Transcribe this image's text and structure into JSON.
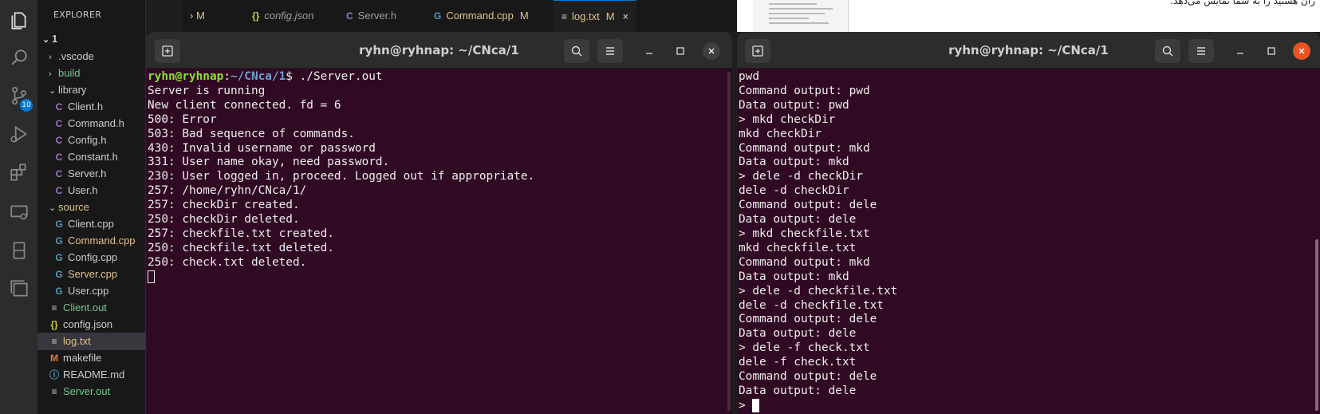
{
  "vscode": {
    "explorer_title": "EXPLORER",
    "explorer_more": "···",
    "source_control_badge": "10",
    "folder_name": "1",
    "tree": [
      {
        "kind": "folder",
        "label": ".vscode",
        "expanded": false,
        "indent": 1,
        "color": "#cccccc"
      },
      {
        "kind": "folder",
        "label": "build",
        "expanded": false,
        "indent": 1,
        "color": "#73c991"
      },
      {
        "kind": "folder",
        "label": "library",
        "expanded": true,
        "indent": 1,
        "color": "#cccccc"
      },
      {
        "kind": "file",
        "icon": "C",
        "icon_color": "#a074c4",
        "label": "Client.h",
        "indent": 2,
        "color": "#cccccc"
      },
      {
        "kind": "file",
        "icon": "C",
        "icon_color": "#a074c4",
        "label": "Command.h",
        "indent": 2,
        "color": "#cccccc"
      },
      {
        "kind": "file",
        "icon": "C",
        "icon_color": "#a074c4",
        "label": "Config.h",
        "indent": 2,
        "color": "#cccccc"
      },
      {
        "kind": "file",
        "icon": "C",
        "icon_color": "#a074c4",
        "label": "Constant.h",
        "indent": 2,
        "color": "#cccccc"
      },
      {
        "kind": "file",
        "icon": "C",
        "icon_color": "#a074c4",
        "label": "Server.h",
        "indent": 2,
        "color": "#cccccc"
      },
      {
        "kind": "file",
        "icon": "C",
        "icon_color": "#a074c4",
        "label": "User.h",
        "indent": 2,
        "color": "#cccccc"
      },
      {
        "kind": "folder",
        "label": "source",
        "expanded": true,
        "indent": 1,
        "color": "#e2c08d"
      },
      {
        "kind": "file",
        "icon": "G",
        "icon_color": "#519aba",
        "label": "Client.cpp",
        "indent": 2,
        "color": "#cccccc"
      },
      {
        "kind": "file",
        "icon": "G",
        "icon_color": "#519aba",
        "label": "Command.cpp",
        "indent": 2,
        "color": "#e2c08d"
      },
      {
        "kind": "file",
        "icon": "G",
        "icon_color": "#519aba",
        "label": "Config.cpp",
        "indent": 2,
        "color": "#cccccc"
      },
      {
        "kind": "file",
        "icon": "G",
        "icon_color": "#519aba",
        "label": "Server.cpp",
        "indent": 2,
        "color": "#e2c08d"
      },
      {
        "kind": "file",
        "icon": "G",
        "icon_color": "#519aba",
        "label": "User.cpp",
        "indent": 2,
        "color": "#cccccc"
      },
      {
        "kind": "file",
        "icon": "≡",
        "icon_color": "#cccccc",
        "label": "Client.out",
        "indent": 1,
        "color": "#73c991"
      },
      {
        "kind": "file",
        "icon": "{}",
        "icon_color": "#cbcb41",
        "label": "config.json",
        "indent": 1,
        "color": "#cccccc"
      },
      {
        "kind": "file",
        "icon": "≡",
        "icon_color": "#cccccc",
        "label": "log.txt",
        "indent": 1,
        "color": "#e2c08d",
        "selected": true
      },
      {
        "kind": "file",
        "icon": "M",
        "icon_color": "#e37933",
        "label": "makefile",
        "indent": 1,
        "color": "#cccccc"
      },
      {
        "kind": "file",
        "icon": "ⓘ",
        "icon_color": "#519aba",
        "label": "README.md",
        "indent": 1,
        "color": "#cccccc"
      },
      {
        "kind": "file",
        "icon": "≡",
        "icon_color": "#cccccc",
        "label": "Server.out",
        "indent": 1,
        "color": "#73c991"
      }
    ],
    "tabs": [
      {
        "icon": "",
        "label": "› M",
        "status": "",
        "color": "#e2c08d"
      },
      {
        "icon": "{}",
        "icon_color": "#cbcb41",
        "label": "config.json",
        "status": "",
        "color": "#9d9d9d",
        "italic": true
      },
      {
        "icon": "C",
        "icon_color": "#a074c4",
        "label": "Server.h",
        "status": "",
        "color": "#9d9d9d"
      },
      {
        "icon": "G",
        "icon_color": "#519aba",
        "label": "Command.cpp",
        "status": "M",
        "color": "#e2c08d"
      },
      {
        "icon": "≡",
        "icon_color": "#cccccc",
        "label": "log.txt",
        "status": "M",
        "color": "#e2c08d",
        "active": true
      }
    ],
    "tab_close": "×"
  },
  "terminal_left": {
    "title": "ryhn@ryhnap: ~/CNca/1",
    "prompt_user": "ryhn@ryhnap",
    "prompt_path": "~/CNca/1",
    "prompt_cmd": "$ ./Server.out",
    "lines": [
      "Server is running",
      "New client connected. fd = 6",
      "500: Error",
      "503: Bad sequence of commands.",
      "430: Invalid username or password",
      "331: User name okay, need password.",
      "230: User logged in, proceed. Logged out if appropriate.",
      "257: /home/ryhn/CNca/1/",
      "257: checkDir created.",
      "250: checkDir deleted.",
      "257: checkfile.txt created.",
      "250: checkfile.txt deleted.",
      "250: check.txt deleted."
    ]
  },
  "terminal_right": {
    "title": "ryhn@ryhnap: ~/CNca/1",
    "lines": [
      "pwd",
      "Command output: pwd",
      "Data output: pwd",
      "> mkd checkDir",
      "mkd checkDir",
      "Command output: mkd",
      "Data output: mkd",
      "> dele -d checkDir",
      "dele -d checkDir",
      "Command output: dele",
      "Data output: dele",
      "> mkd checkfile.txt",
      "mkd checkfile.txt",
      "Command output: mkd",
      "Data output: mkd",
      "> dele -d checkfile.txt",
      "dele -d checkfile.txt",
      "Command output: dele",
      "Data output: dele",
      "> dele -f check.txt",
      "dele -f check.txt",
      "Command output: dele",
      "Data output: dele"
    ],
    "final_prompt": "> "
  },
  "background_doc": {
    "rtl_text": "ران هستید را به شما نمایش می‌دهد."
  },
  "colors": {
    "terminal_bg": "#300a24",
    "prompt_user": "#8ae234",
    "prompt_path": "#729fcf",
    "accent": "#0078d4",
    "close_button": "#e95420"
  }
}
